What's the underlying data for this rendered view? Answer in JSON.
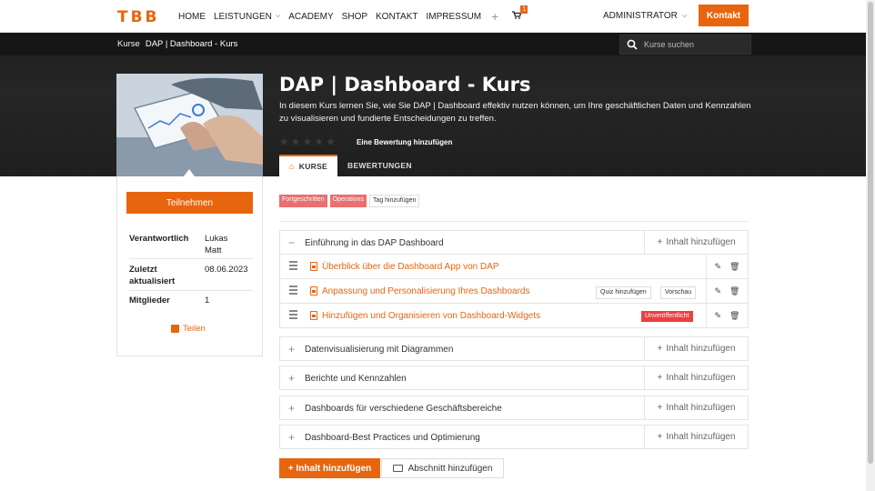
{
  "nav": {
    "logo": "TBB",
    "items": [
      {
        "label": "HOME",
        "dropdown": false
      },
      {
        "label": "LEISTUNGEN",
        "dropdown": true
      },
      {
        "label": "ACADEMY",
        "dropdown": false
      },
      {
        "label": "SHOP",
        "dropdown": false
      },
      {
        "label": "KONTAKT",
        "dropdown": false
      },
      {
        "label": "IMPRESSUM",
        "dropdown": false
      }
    ],
    "plus": "+",
    "cart_count": "1",
    "user": "ADMINISTRATOR",
    "contact_button": "Kontakt"
  },
  "breadcrumb": {
    "root": "Kurse",
    "current": "DAP | Dashboard - Kurs"
  },
  "search": {
    "placeholder": "Kurse suchen"
  },
  "course": {
    "title": "DAP | Dashboard - Kurs",
    "description": "In diesem Kurs lernen Sie, wie Sie DAP | Dashboard effektiv nutzen können, um Ihre geschäftlichen Daten und Kennzahlen zu visualisieren und fundierte Entscheidungen zu treffen.",
    "rating_stars": 0,
    "rating_link": "Eine Bewertung hinzufügen"
  },
  "tabs": [
    {
      "label": "KURSE",
      "active": true
    },
    {
      "label": "BEWERTUNGEN",
      "active": false
    }
  ],
  "sidebar": {
    "enroll_button": "Teilnehmen",
    "meta": [
      {
        "key": "Verantwortlich",
        "value": "Lukas Matt"
      },
      {
        "key": "Zuletzt aktualisiert",
        "value": "08.06.2023"
      },
      {
        "key": "Mitglieder",
        "value": "1"
      }
    ],
    "share": "Teilen"
  },
  "tags": [
    {
      "label": "Fortgeschritten",
      "style": "red"
    },
    {
      "label": "Operations",
      "style": "red"
    },
    {
      "label": "Tag hinzufügen",
      "style": "outline"
    }
  ],
  "add_content_label": "Inhalt hinzufügen",
  "sections": [
    {
      "title": "Einführung in das DAP Dashboard",
      "expanded": true
    },
    {
      "title": "Datenvisualisierung mit Diagrammen",
      "expanded": false
    },
    {
      "title": "Berichte und Kennzahlen",
      "expanded": false
    },
    {
      "title": "Dashboards für verschiedene Geschäftsbereiche",
      "expanded": false
    },
    {
      "title": "Dashboard-Best Practices und Optimierung",
      "expanded": false
    }
  ],
  "lessons": [
    {
      "title": "Überblick über die Dashboard App von DAP",
      "badges": []
    },
    {
      "title": "Anpassung und Personalisierung Ihres Dashboards",
      "badges": [
        "Quiz hinzufügen",
        "Vorschau"
      ]
    },
    {
      "title": "Hinzufügen und Organisieren von Dashboard-Widgets",
      "badges": [
        "Unveröffentlicht"
      ]
    }
  ],
  "footer_buttons": {
    "add_content": "Inhalt hinzufügen",
    "add_section": "Abschnitt hinzufügen"
  },
  "colors": {
    "accent": "#e8650f",
    "dark": "#1e1e1e",
    "tag_red": "#e9706f",
    "unpublished": "#e94040"
  }
}
